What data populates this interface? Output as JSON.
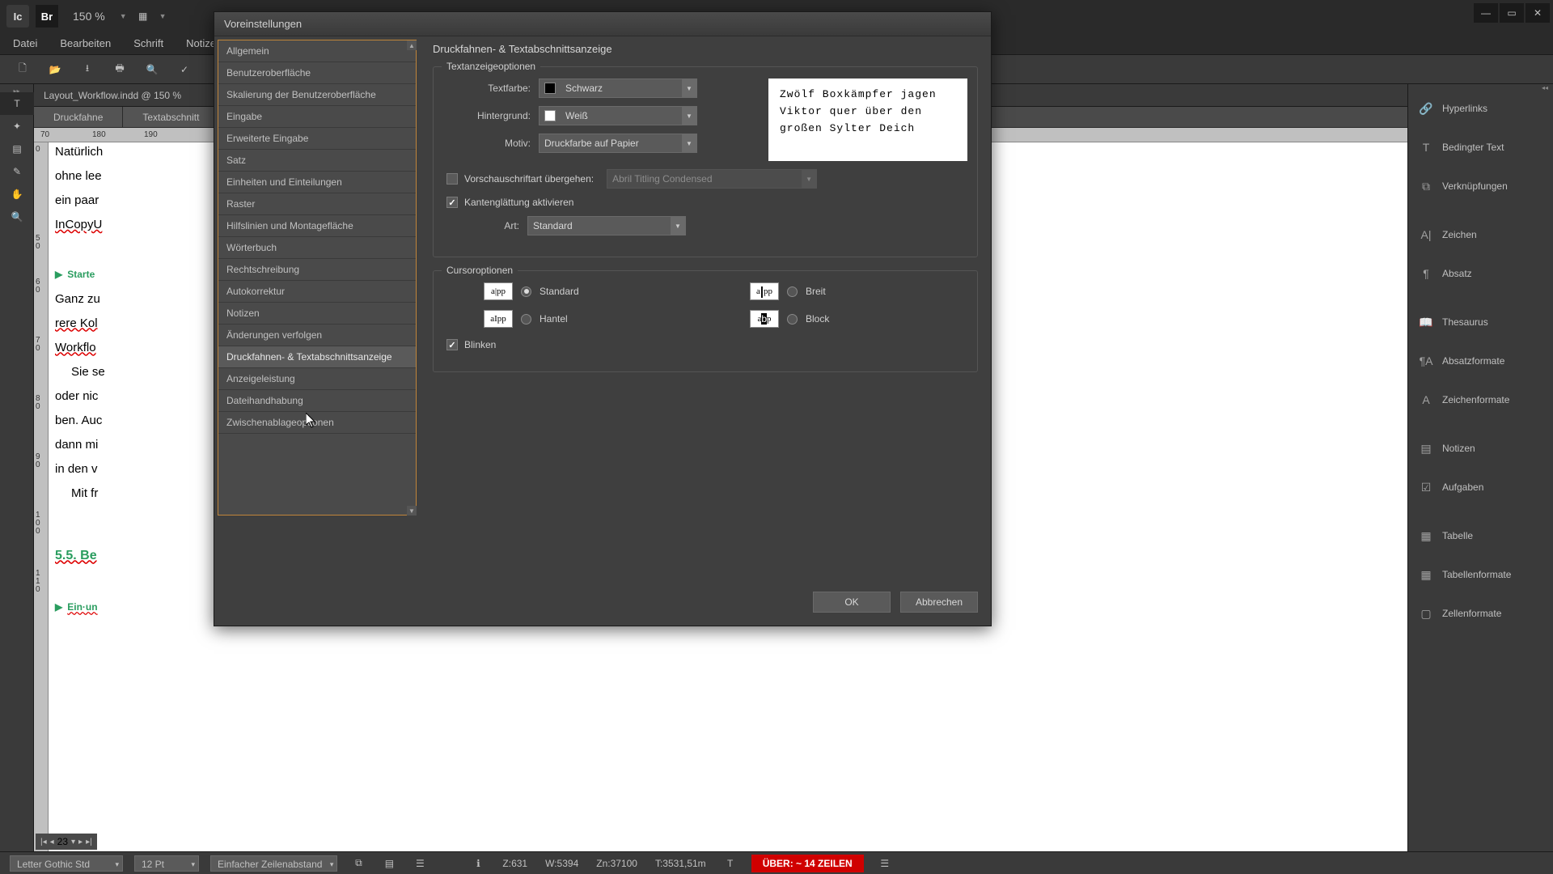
{
  "app": {
    "icon": "Ic",
    "bridge": "Br",
    "zoom": "150 %"
  },
  "menu": {
    "file": "Datei",
    "edit": "Bearbeiten",
    "font": "Schrift",
    "notes": "Notizen"
  },
  "doc": {
    "tab_title": "Layout_Workflow.indd @ 150 %",
    "view_tabs": {
      "galley": "Druckfahne",
      "story": "Textabschnitt"
    },
    "ruler_h": [
      "70",
      "180",
      "190"
    ],
    "ruler_v": [
      "0",
      "5",
      "0",
      "6",
      "0",
      "7",
      "0",
      "8",
      "0",
      "9",
      "0",
      "1",
      "0",
      "0",
      "1",
      "1",
      "0"
    ],
    "body": {
      "l1": "Natürlich",
      "l2": "ohne lee",
      "l3": "ein paar",
      "l4": "InCopyU",
      "h1": "Starte",
      "l5": "Ganz zu",
      "l6": "rere Kol",
      "l7": "Workflo",
      "l8": "Sie se",
      "l9": "oder nic",
      "l10": "ben. Auc",
      "l11": "dann mi",
      "l12": "in den v",
      "l13": "Mit fr",
      "h2": "5.5.  Be",
      "h3": "Ein·un"
    }
  },
  "pagination": {
    "page": "23"
  },
  "panels": {
    "hyperlinks": "Hyperlinks",
    "conditional": "Bedingter Text",
    "links": "Verknüpfungen",
    "char": "Zeichen",
    "para": "Absatz",
    "thesaurus": "Thesaurus",
    "para_styles": "Absatzformate",
    "char_styles": "Zeichenformate",
    "notes": "Notizen",
    "assignments": "Aufgaben",
    "table": "Tabelle",
    "table_styles": "Tabellenformate",
    "cell_styles": "Zellenformate"
  },
  "dialog": {
    "title": "Voreinstellungen",
    "sidebar": [
      "Allgemein",
      "Benutzeroberfläche",
      "Skalierung der Benutzeroberfläche",
      "Eingabe",
      "Erweiterte Eingabe",
      "Satz",
      "Einheiten und Einteilungen",
      "Raster",
      "Hilfslinien und Montagefläche",
      "Wörterbuch",
      "Rechtschreibung",
      "Autokorrektur",
      "Notizen",
      "Änderungen verfolgen",
      "Druckfahnen- & Textabschnittsanzeige",
      "Anzeigeleistung",
      "Dateihandhabung",
      "Zwischenablageoptionen"
    ],
    "active_index": 14,
    "main": {
      "title": "Druckfahnen- & Textabschnittsanzeige",
      "section1": {
        "legend": "Textanzeigeoptionen",
        "text_color_label": "Textfarbe:",
        "text_color_value": "Schwarz",
        "bg_label": "Hintergrund:",
        "bg_value": "Weiß",
        "theme_label": "Motiv:",
        "theme_value": "Druckfarbe auf Papier",
        "preview": "Zwölf Boxkämpfer jagen Viktor quer über den großen Sylter Deich",
        "override_font_label": "Vorschauschriftart übergehen:",
        "override_font_value": "Abril Titling Condensed",
        "antialias_label": "Kantenglättung aktivieren",
        "type_label": "Art:",
        "type_value": "Standard"
      },
      "section2": {
        "legend": "Cursoroptionen",
        "opt1": "Standard",
        "opt2": "Breit",
        "opt3": "Hantel",
        "opt4": "Block",
        "blink": "Blinken"
      },
      "ok": "OK",
      "cancel": "Abbrechen"
    }
  },
  "status": {
    "font": "Letter Gothic Std",
    "size": "12 Pt",
    "spacing": "Einfacher Zeilenabstand",
    "z": "Z:631",
    "w": "W:5394",
    "zn": "Zn:37100",
    "t": "T:3531,51m",
    "warning": "ÜBER:  ~ 14 ZEILEN"
  }
}
